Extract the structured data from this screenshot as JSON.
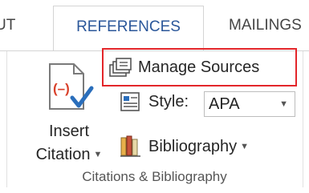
{
  "tabs": {
    "left_partial": "UT",
    "active": "REFERENCES",
    "right_partial": "MAILINGS"
  },
  "group": {
    "label": "Citations & Bibliography",
    "insert_citation": {
      "line1": "Insert",
      "line2": "Citation",
      "icon": "insert-citation-icon"
    },
    "manage_sources": {
      "label": "Manage Sources",
      "icon": "manage-sources-icon"
    },
    "style": {
      "label": "Style:",
      "value": "APA",
      "icon": "style-icon"
    },
    "bibliography": {
      "label": "Bibliography",
      "icon": "bibliography-icon"
    }
  },
  "colors": {
    "active_tab_text": "#2b579a",
    "highlight_border": "#e3262a",
    "citation_red": "#d9412b",
    "check_blue": "#2a6ebb"
  }
}
